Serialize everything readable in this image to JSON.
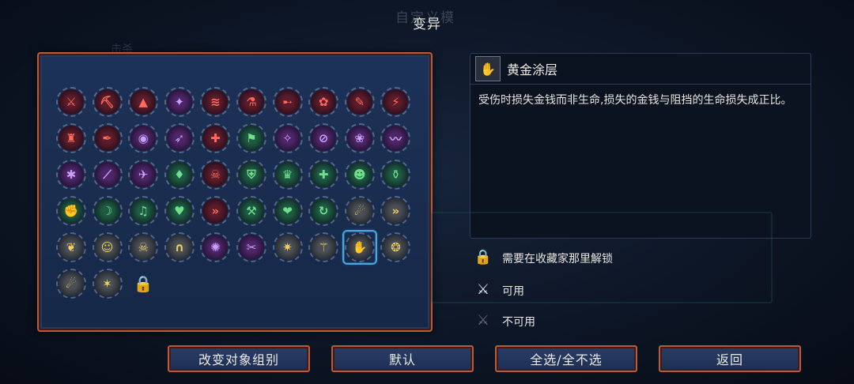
{
  "background": {
    "ghost_title": "自定义模",
    "ghost_sub": "击杀"
  },
  "title": "变异",
  "grid": {
    "selected_index": 48,
    "items": [
      {
        "c": "red",
        "g": "⚔"
      },
      {
        "c": "red",
        "g": "⛏"
      },
      {
        "c": "red",
        "g": "▲"
      },
      {
        "c": "purple",
        "g": "✦"
      },
      {
        "c": "red",
        "g": "≋"
      },
      {
        "c": "red",
        "g": "⚗"
      },
      {
        "c": "red",
        "g": "➸"
      },
      {
        "c": "red",
        "g": "✿"
      },
      {
        "c": "red",
        "g": "✎"
      },
      {
        "c": "red",
        "g": "⚡"
      },
      {
        "c": "red",
        "g": "♜"
      },
      {
        "c": "red",
        "g": "✒"
      },
      {
        "c": "purple",
        "g": "◉"
      },
      {
        "c": "purple",
        "g": "➶"
      },
      {
        "c": "red",
        "g": "✚"
      },
      {
        "c": "green",
        "g": "⚑"
      },
      {
        "c": "purple",
        "g": "✧"
      },
      {
        "c": "purple",
        "g": "⊘"
      },
      {
        "c": "purple",
        "g": "❀"
      },
      {
        "c": "purple",
        "g": "〰"
      },
      {
        "c": "purple",
        "g": "✱"
      },
      {
        "c": "purple",
        "g": "⟋"
      },
      {
        "c": "purple",
        "g": "✈"
      },
      {
        "c": "green",
        "g": "♦"
      },
      {
        "c": "red",
        "g": "☠"
      },
      {
        "c": "green",
        "g": "⛨"
      },
      {
        "c": "green",
        "g": "♛"
      },
      {
        "c": "green",
        "g": "✚"
      },
      {
        "c": "green",
        "g": "☻"
      },
      {
        "c": "green",
        "g": "⚱"
      },
      {
        "c": "green",
        "g": "✊"
      },
      {
        "c": "green",
        "g": "☽"
      },
      {
        "c": "green",
        "g": "♫"
      },
      {
        "c": "green",
        "g": "♥"
      },
      {
        "c": "red",
        "g": "»"
      },
      {
        "c": "green",
        "g": "⚒"
      },
      {
        "c": "green",
        "g": "❤"
      },
      {
        "c": "green",
        "g": "↻"
      },
      {
        "c": "gray",
        "g": "☄"
      },
      {
        "c": "gray",
        "g": "»"
      },
      {
        "c": "gray",
        "g": "❦"
      },
      {
        "c": "gray",
        "g": "☺"
      },
      {
        "c": "gray",
        "g": "☠"
      },
      {
        "c": "gray",
        "g": "∩"
      },
      {
        "c": "purple",
        "g": "✺"
      },
      {
        "c": "purple",
        "g": "✂"
      },
      {
        "c": "gray",
        "g": "✷"
      },
      {
        "c": "gray",
        "g": "⚚"
      },
      {
        "c": "gray",
        "g": "✋"
      },
      {
        "c": "gray",
        "g": "❂"
      },
      {
        "c": "gray",
        "g": "☄"
      },
      {
        "c": "gray",
        "g": "✶"
      },
      {
        "c": "lockicon",
        "g": "🔒"
      }
    ]
  },
  "detail": {
    "icon": "✋",
    "name": "黄金涂层",
    "description": "受伤时损失金钱而非生命,损失的金钱与阻挡的生命损失成正比。"
  },
  "legend": [
    {
      "icon": "🔒",
      "label": "需要在收藏家那里解锁",
      "color": "#d8303a"
    },
    {
      "icon": "⚔",
      "label": "可用",
      "color": "#e8e8f0"
    },
    {
      "icon": "⚔",
      "label": "不可用",
      "color": "#6a6a72"
    }
  ],
  "buttons": {
    "change_group": "改变对象组别",
    "default": "默认",
    "select_all": "全选/全不选",
    "back": "返回"
  }
}
